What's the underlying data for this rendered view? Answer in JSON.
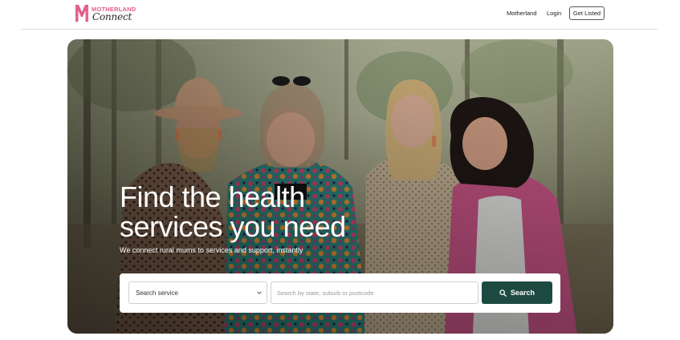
{
  "brand": {
    "logo_text_top": "MOTHERLAND",
    "logo_text_bottom": "Connect",
    "logo_color": "#e45c8c"
  },
  "nav": {
    "motherland_label": "Motherland",
    "login_label": "Login",
    "cta_label": "Get Listed"
  },
  "hero": {
    "headline_line1": "Find the health",
    "headline_line2": "services you need",
    "subhead": "We connect rural mums to services and support, instantly"
  },
  "search": {
    "service_selected": "Search service",
    "location_placeholder": "Search by state, suburb or postcode",
    "button_label": "Search",
    "button_icon": "search-icon",
    "button_color": "#1d4a40"
  }
}
